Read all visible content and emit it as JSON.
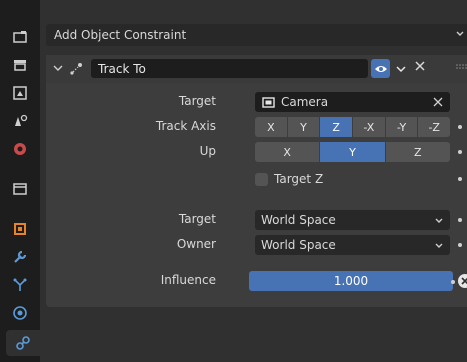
{
  "add_constraint": {
    "label": "Add Object Constraint"
  },
  "constraint": {
    "name": "Track To",
    "visible": true,
    "target": {
      "label": "Target",
      "value": "Camera"
    },
    "track_axis": {
      "label": "Track Axis",
      "options": [
        "X",
        "Y",
        "Z",
        "-X",
        "-Y",
        "-Z"
      ],
      "selected": "Z"
    },
    "up": {
      "label": "Up",
      "options": [
        "X",
        "Y",
        "Z"
      ],
      "selected": "Y"
    },
    "target_z": {
      "label": "Target Z",
      "checked": false
    },
    "target_space": {
      "label": "Target",
      "value": "World Space"
    },
    "owner_space": {
      "label": "Owner",
      "value": "World Space"
    },
    "influence": {
      "label": "Influence",
      "value": "1.000",
      "fraction": 1.0
    }
  },
  "tabs": [
    {
      "icon": "tool-icon"
    },
    {
      "icon": "render-icon"
    },
    {
      "icon": "output-icon"
    },
    {
      "icon": "view-layer-icon"
    },
    {
      "icon": "scene-icon"
    },
    {
      "icon": "world-icon"
    },
    {
      "icon": "collection-icon"
    },
    {
      "icon": "object-icon"
    },
    {
      "icon": "modifier-icon"
    },
    {
      "icon": "particles-icon"
    },
    {
      "icon": "physics-icon"
    },
    {
      "icon": "object-constraint-icon"
    }
  ],
  "colors": {
    "accent": "#4772b3",
    "panel": "#303030",
    "card": "#3d3d3d",
    "field": "#1d1d1d",
    "button": "#545454"
  }
}
